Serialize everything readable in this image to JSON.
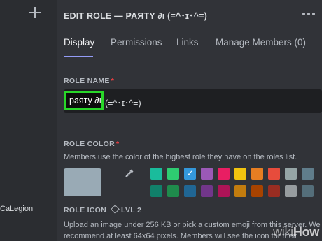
{
  "header": {
    "title": "EDIT ROLE — PAЯТY ∂ı (=^･ɪ･^=)"
  },
  "tabs": [
    {
      "label": "Display",
      "active": true
    },
    {
      "label": "Permissions",
      "active": false
    },
    {
      "label": "Links",
      "active": false
    },
    {
      "label": "Manage Members (0)",
      "active": false
    }
  ],
  "role_name": {
    "label": "ROLE NAME",
    "required_mark": "*",
    "value_selected": "paяту ∂ı",
    "value_rest": "(=^･ɪ･^=)"
  },
  "role_color": {
    "label": "ROLE COLOR",
    "required_mark": "*",
    "description": "Members use the color of the highest role they have on the roles list.",
    "default_color": "#99aab5",
    "swatches_top": [
      "#1abc9c",
      "#2ecc71",
      "#3498db",
      "#9b59b6",
      "#e91e63",
      "#f1c40f",
      "#e67e22",
      "#e74c3c",
      "#95a5a6",
      "#607d8b"
    ],
    "swatches_bottom": [
      "#11806a",
      "#1f8b4c",
      "#206694",
      "#71368a",
      "#ad1457",
      "#c27c0e",
      "#a84300",
      "#992d22",
      "#979c9f",
      "#546e7a"
    ],
    "selected_index_top": 2
  },
  "role_icon": {
    "label": "ROLE ICON",
    "level": "LVL 2",
    "line1": "Upload an image under 256 KB or pick a custom emoji from this server. We",
    "line2": "recommend at least 64x64 pixels. Members will see the icon for their"
  },
  "sidebar": {
    "role_name": "CaLegion"
  },
  "watermark": {
    "wiki": "wiki",
    "how": "How"
  }
}
